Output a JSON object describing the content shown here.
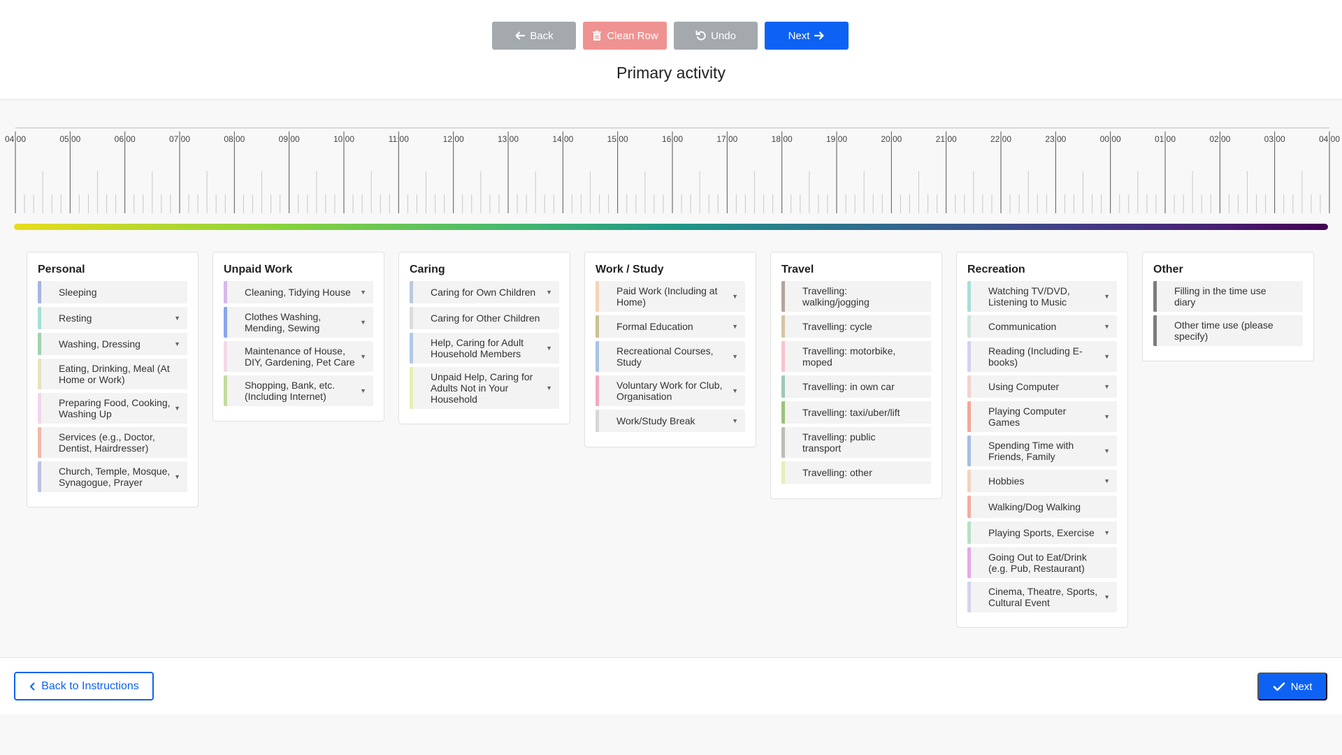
{
  "toolbar": {
    "back_label": "Back",
    "clean_label": "Clean Row",
    "undo_label": "Undo",
    "next_label": "Next"
  },
  "page_title": "Primary activity",
  "timeline": {
    "hours": [
      "04:00",
      "05:00",
      "06:00",
      "07:00",
      "08:00",
      "09:00",
      "10:00",
      "11:00",
      "12:00",
      "13:00",
      "14:00",
      "15:00",
      "16:00",
      "17:00",
      "18:00",
      "19:00",
      "20:00",
      "21:00",
      "22:00",
      "23:00",
      "00:00",
      "01:00",
      "02:00",
      "03:00",
      "04:00"
    ]
  },
  "categories": [
    {
      "title": "Personal",
      "activities": [
        {
          "label": "Sleeping",
          "color": "#a8b4e0",
          "dropdown": false
        },
        {
          "label": "Resting",
          "color": "#a6dfd6",
          "dropdown": true
        },
        {
          "label": "Washing, Dressing",
          "color": "#a3d1b0",
          "dropdown": true
        },
        {
          "label": "Eating, Drinking, Meal (At Home or Work)",
          "color": "#e5e3bf",
          "dropdown": false
        },
        {
          "label": "Preparing Food, Cooking, Washing Up",
          "color": "#f1d5ed",
          "dropdown": true
        },
        {
          "label": "Services (e.g., Doctor, Dentist, Hairdresser)",
          "color": "#f2b8a8",
          "dropdown": false
        },
        {
          "label": "Church, Temple, Mosque, Synagogue, Prayer",
          "color": "#bcc1df",
          "dropdown": true
        }
      ]
    },
    {
      "title": "Unpaid Work",
      "activities": [
        {
          "label": "Cleaning, Tidying House",
          "color": "#d7b8ec",
          "dropdown": true
        },
        {
          "label": "Clothes Washing, Mending, Sewing",
          "color": "#8aa5e9",
          "dropdown": true
        },
        {
          "label": "Maintenance of House, DIY, Gardening, Pet Care",
          "color": "#f3d9e6",
          "dropdown": true
        },
        {
          "label": "Shopping, Bank, etc. (Including Internet)",
          "color": "#c4db9c",
          "dropdown": true
        }
      ]
    },
    {
      "title": "Caring",
      "activities": [
        {
          "label": "Caring for Own Children",
          "color": "#bcc9dc",
          "dropdown": true
        },
        {
          "label": "Caring for Other Children",
          "color": "#dcdcdc",
          "dropdown": false
        },
        {
          "label": "Help, Caring for Adult Household Members",
          "color": "#b2c8e5",
          "dropdown": true
        },
        {
          "label": "Unpaid Help, Caring for Adults Not in Your Household",
          "color": "#e4efb6",
          "dropdown": true
        }
      ]
    },
    {
      "title": "Work / Study",
      "activities": [
        {
          "label": "Paid Work (Including at Home)",
          "color": "#f4d4b6",
          "dropdown": true
        },
        {
          "label": "Formal Education",
          "color": "#c8c195",
          "dropdown": true
        },
        {
          "label": "Recreational Courses, Study",
          "color": "#a7c3e6",
          "dropdown": true
        },
        {
          "label": "Voluntary Work for Club, Organisation",
          "color": "#f1a9c2",
          "dropdown": true
        },
        {
          "label": "Work/Study Break",
          "color": "#d7d7d7",
          "dropdown": true
        }
      ]
    },
    {
      "title": "Travel",
      "activities": [
        {
          "label": "Travelling: walking/jogging",
          "color": "#b3a59e",
          "dropdown": false
        },
        {
          "label": "Travelling: cycle",
          "color": "#d4c6a4",
          "dropdown": false
        },
        {
          "label": "Travelling: motorbike, moped",
          "color": "#f7c4cc",
          "dropdown": false
        },
        {
          "label": "Travelling: in own car",
          "color": "#9fc9b4",
          "dropdown": false
        },
        {
          "label": "Travelling: taxi/uber/lift",
          "color": "#9cc37a",
          "dropdown": false
        },
        {
          "label": "Travelling: public transport",
          "color": "#bdbcb5",
          "dropdown": false
        },
        {
          "label": "Travelling: other",
          "color": "#e8ecb9",
          "dropdown": false
        }
      ]
    },
    {
      "title": "Recreation",
      "activities": [
        {
          "label": "Watching TV/DVD, Listening to Music",
          "color": "#a6dfd8",
          "dropdown": true
        },
        {
          "label": "Communication",
          "color": "#cfe4dd",
          "dropdown": true
        },
        {
          "label": "Reading (Including E-books)",
          "color": "#d4d1ee",
          "dropdown": true
        },
        {
          "label": "Using Computer",
          "color": "#f4d2d0",
          "dropdown": true
        },
        {
          "label": "Playing Computer Games",
          "color": "#f2a896",
          "dropdown": true
        },
        {
          "label": "Spending Time with Friends, Family",
          "color": "#a7bde1",
          "dropdown": true
        },
        {
          "label": "Hobbies",
          "color": "#f3d2c0",
          "dropdown": true
        },
        {
          "label": "Walking/Dog Walking",
          "color": "#f4ada0",
          "dropdown": false
        },
        {
          "label": "Playing Sports, Exercise",
          "color": "#b7e0c6",
          "dropdown": true
        },
        {
          "label": "Going Out to Eat/Drink (e.g. Pub, Restaurant)",
          "color": "#e5a9e6",
          "dropdown": false
        },
        {
          "label": "Cinema, Theatre, Sports, Cultural Event",
          "color": "#d6d2ed",
          "dropdown": true
        }
      ]
    },
    {
      "title": "Other",
      "activities": [
        {
          "label": "Filling in the time use diary",
          "color": "#7d7d7d",
          "dropdown": false
        },
        {
          "label": "Other time use (please specify)",
          "color": "#7d7d7d",
          "dropdown": false
        }
      ]
    }
  ],
  "footer": {
    "back_instructions_label": "Back to Instructions",
    "next_label": "Next"
  },
  "colors": {
    "primary": "#0d62f4",
    "neutral_button": "#a4a9ae",
    "danger_button": "#ef9292"
  }
}
